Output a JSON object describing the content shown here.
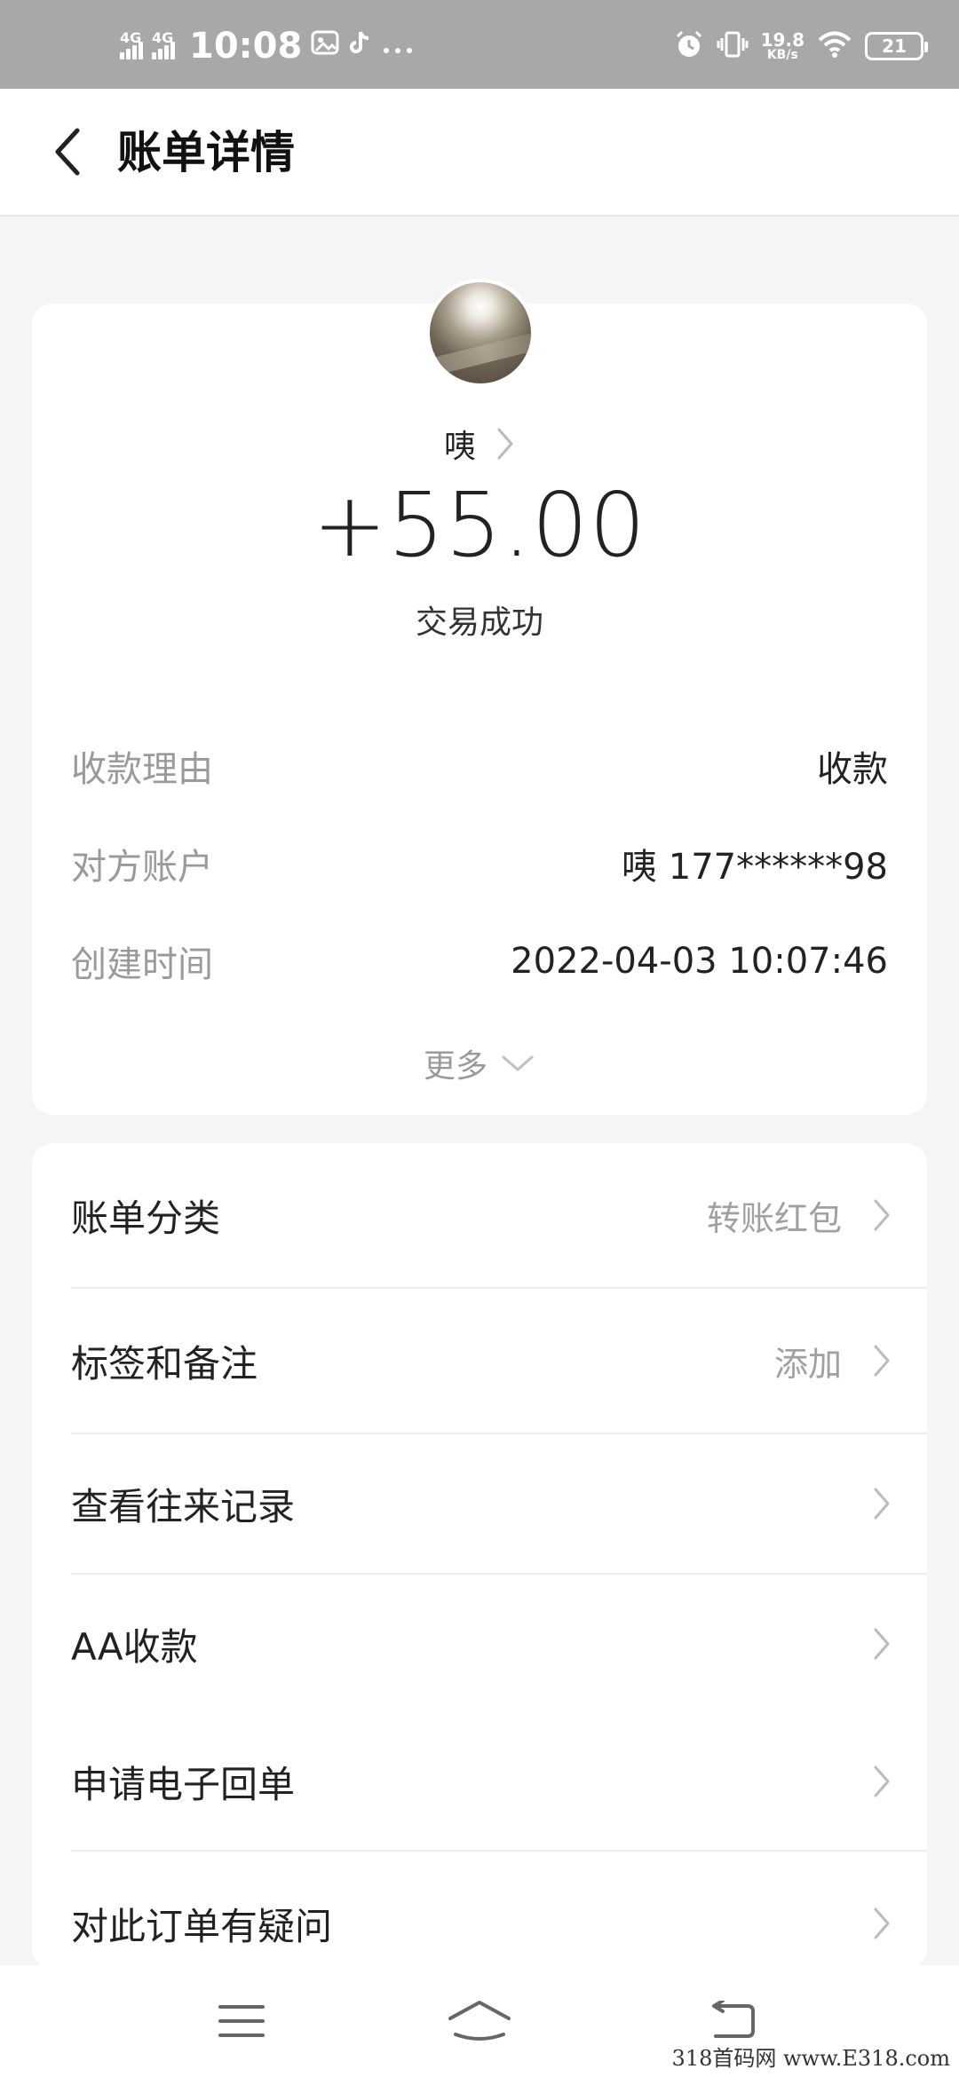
{
  "status_bar": {
    "network1": "4G",
    "network2": "4G",
    "time": "10:08",
    "speed_value": "19.8",
    "speed_unit": "KB/s",
    "battery": "21",
    "icons": [
      "signal-icon",
      "signal-icon",
      "gallery-icon",
      "tiktok-icon",
      "more-dots-icon",
      "alarm-icon",
      "vibrate-icon",
      "wifi-icon",
      "battery-icon"
    ]
  },
  "header": {
    "title": "账单详情",
    "back_icon": "chevron-left-icon"
  },
  "summary": {
    "name": "咦",
    "amount": "+55.00",
    "status": "交易成功"
  },
  "details": [
    {
      "label": "收款理由",
      "value": "收款"
    },
    {
      "label": "对方账户",
      "value": "咦 177******98"
    },
    {
      "label": "创建时间",
      "value": "2022-04-03 10:07:46"
    }
  ],
  "more": "更多",
  "menu": [
    {
      "label": "账单分类",
      "value": "转账红包"
    },
    {
      "label": "标签和备注",
      "value": "添加"
    },
    {
      "label": "查看往来记录",
      "value": ""
    },
    {
      "label": "AA收款",
      "value": ""
    },
    {
      "label": "申请电子回单",
      "value": ""
    },
    {
      "label": "对此订单有疑问",
      "value": ""
    }
  ],
  "watermark": "318首码网 www.E318.com",
  "colors": {
    "status_bar_bg": "#a8a8a8",
    "page_bg": "#f5f5f5",
    "card_bg": "#ffffff",
    "primary_text": "#222222",
    "secondary_text": "#9a9a9a"
  }
}
